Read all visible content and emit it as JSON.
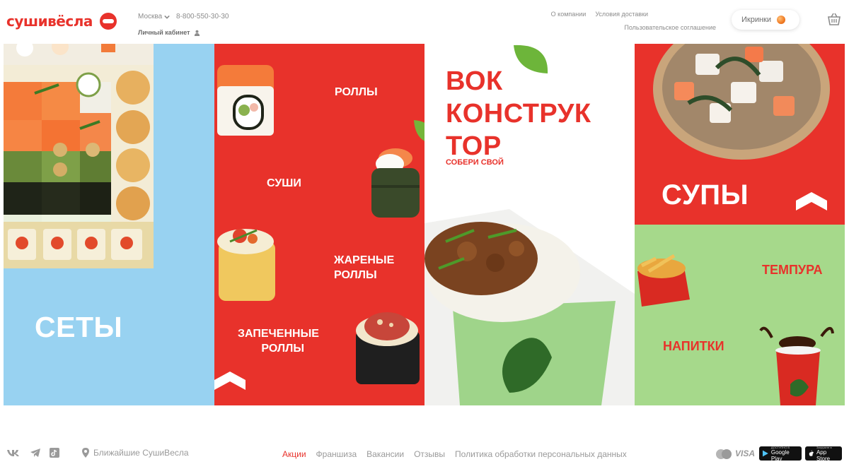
{
  "header": {
    "logo_text": "сушивёсла",
    "city": "Москва",
    "phone": "8-800-550-30-30",
    "cabinet": "Личный кабинет",
    "links": [
      "О компании",
      "Условия доставки"
    ],
    "link_agreement": "Пользовательское соглашение",
    "caviar": "Икринки"
  },
  "categories": {
    "sets": "СЕТЫ",
    "rolls": "РОЛЛЫ",
    "sushi": "СУШИ",
    "fried_rolls_1": "ЖАРЕНЫЕ",
    "fried_rolls_2": "РОЛЛЫ",
    "baked_rolls_1": "ЗАПЕЧЕННЫЕ",
    "baked_rolls_2": "РОЛЛЫ",
    "wok_1": "ВОК",
    "wok_2": "КОНСТРУК",
    "wok_3": "ТОР",
    "wok_sub": "СОБЕРИ СВОЙ",
    "soups": "СУПЫ",
    "tempura": "ТЕМПУРА",
    "drinks": "НАПИТКИ"
  },
  "footer": {
    "nearest": "Ближайшие СушиВесла",
    "links": [
      "Акции",
      "Франшиза",
      "Вакансии",
      "Отзывы",
      "Политика обработки персональных данных"
    ],
    "visa": "VISA",
    "google_small": "ДОСТУПНО В",
    "google": "Google Play",
    "apple_small": "Загрузите в",
    "apple": "App Store"
  },
  "colors": {
    "brand_red": "#e8322b",
    "sets_blue": "#98d2f1",
    "tempura_green": "#a6d98b"
  },
  "icons": [
    "chevron-down-icon",
    "user-icon",
    "basket-icon",
    "vk-icon",
    "telegram-icon",
    "tiktok-icon",
    "location-pin-icon",
    "mastercard-icon"
  ]
}
